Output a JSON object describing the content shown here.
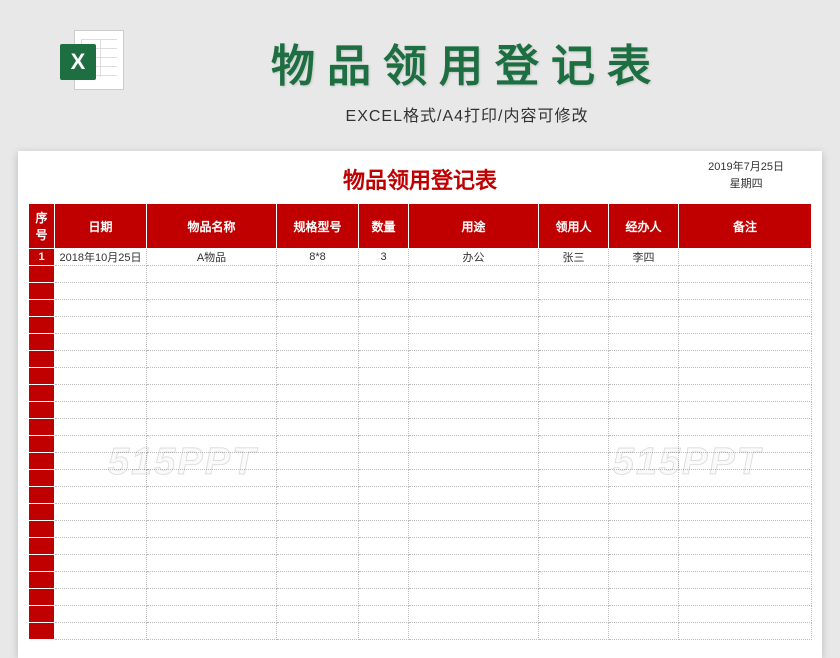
{
  "header": {
    "icon_letter": "X",
    "main_title": "物品领用登记表",
    "subtitle": "EXCEL格式/A4打印/内容可修改"
  },
  "sheet": {
    "title": "物品领用登记表",
    "date": "2019年7月25日",
    "weekday": "星期四"
  },
  "columns": [
    "序号",
    "日期",
    "物品名称",
    "规格型号",
    "数量",
    "用途",
    "领用人",
    "经办人",
    "备注"
  ],
  "rows": [
    {
      "idx": "1",
      "date": "2018年10月25日",
      "name": "A物品",
      "spec": "8*8",
      "qty": "3",
      "use": "办公",
      "p1": "张三",
      "p2": "李四",
      "note": ""
    }
  ],
  "empty_rows": 22,
  "watermark": "515PPT"
}
